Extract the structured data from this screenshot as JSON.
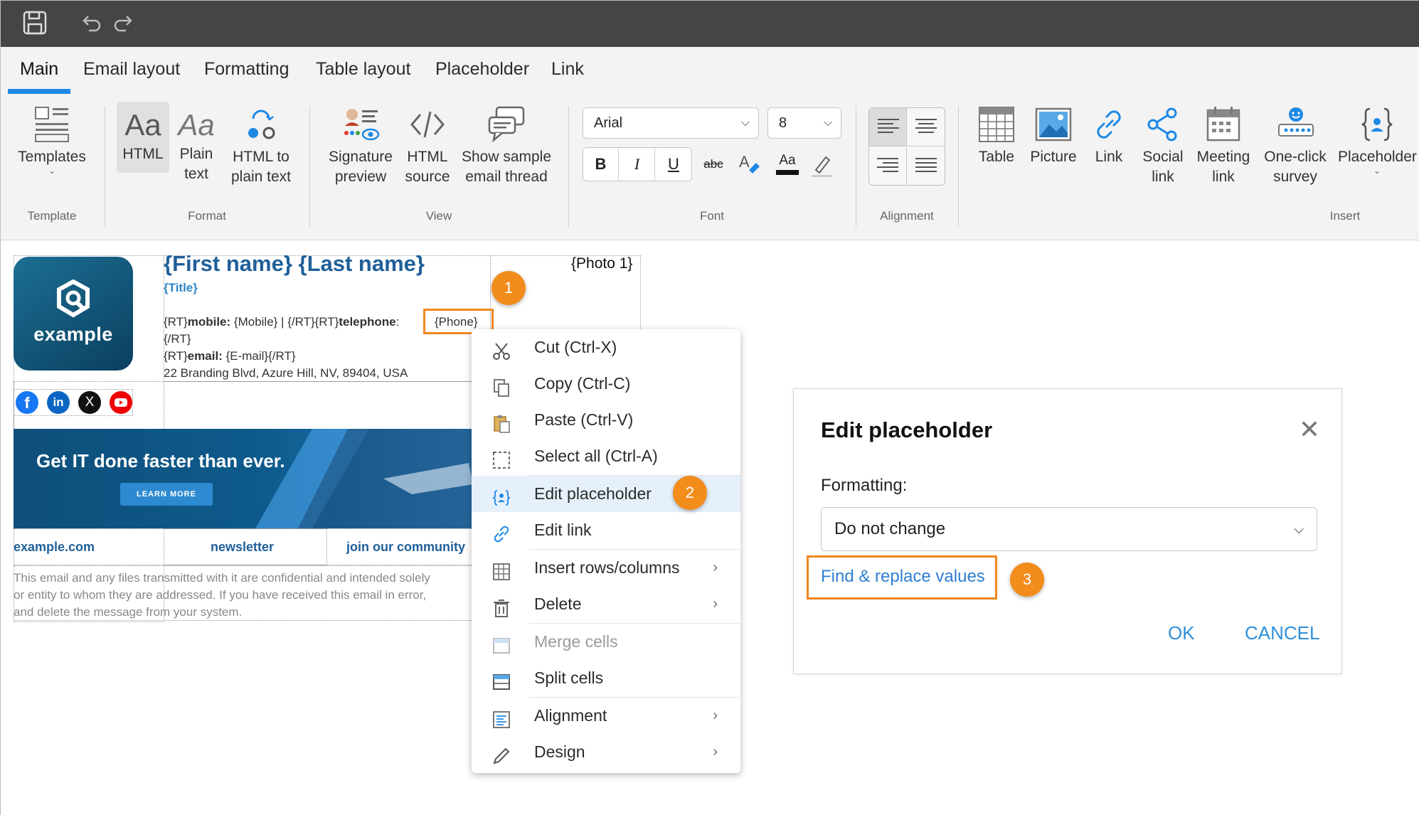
{
  "titlebar": {
    "icons": [
      "save-icon",
      "undo-icon",
      "redo-icon"
    ]
  },
  "tabs": [
    {
      "label": "Main"
    },
    {
      "label": "Email layout"
    },
    {
      "label": "Formatting"
    },
    {
      "label": "Table layout"
    },
    {
      "label": "Placeholder"
    },
    {
      "label": "Link"
    }
  ],
  "ribbon": {
    "templates": "Templates",
    "html": "HTML",
    "html_icon_text": "Aa",
    "plain_text": "Plain text",
    "plain_icon_text": "Aa",
    "html_to_plain": "HTML to plain text",
    "signature_preview": "Signature preview",
    "html_source": "HTML source",
    "show_sample": "Show sample email thread",
    "font_name": "Arial",
    "font_size": "8",
    "bold": "B",
    "italic": "I",
    "underline": "U",
    "strike": "abc",
    "aa": "Aa",
    "table": "Table",
    "picture": "Picture",
    "link": "Link",
    "social_link": "Social link",
    "meeting_link": "Meeting link",
    "one_click_survey": "One-click survey",
    "placeholder": "Placeholder",
    "groups": {
      "template": "Template",
      "format": "Format",
      "view": "View",
      "font": "Font",
      "alignment": "Alignment",
      "insert": "Insert"
    }
  },
  "signature": {
    "logo_text": "example",
    "name": "{First name} {Last name}",
    "title": "{Title}",
    "photo": "{Photo 1}",
    "line1_a": "{RT}",
    "line1_b": "mobile:",
    "line1_c": " {Mobile}  |  {/RT}{RT}",
    "line1_d": "telephone",
    "line1_e": ":",
    "phone": "{Phone}",
    "line2": "{/RT}",
    "line3_a": "{RT}",
    "line3_b": "email:",
    "line3_c": " {E-mail}{/RT}",
    "address": "22 Branding Blvd, Azure Hill, NV, 89404, USA",
    "banner_headline": "Get IT done faster than ever.",
    "banner_button": "LEARN MORE",
    "link1": "example.com",
    "link2": "newsletter",
    "link3": "join our community",
    "disclaimer1": "This email and any files transmitted with it are confidential and intended solely",
    "disclaimer2": "or entity to whom they are addressed. If you have received this email in error,",
    "disclaimer3": "and delete the message from your system."
  },
  "badges": [
    "1",
    "2",
    "3"
  ],
  "context_menu": [
    {
      "label": "Cut (Ctrl-X)"
    },
    {
      "label": "Copy (Ctrl-C)"
    },
    {
      "label": "Paste (Ctrl-V)"
    },
    {
      "label": "Select all (Ctrl-A)"
    },
    {
      "label": "Edit placeholder"
    },
    {
      "label": "Edit link"
    },
    {
      "label": "Insert rows/columns"
    },
    {
      "label": "Delete"
    },
    {
      "label": "Merge cells",
      "disabled": true
    },
    {
      "label": "Split cells"
    },
    {
      "label": "Alignment"
    },
    {
      "label": "Design"
    }
  ],
  "dialog": {
    "title": "Edit placeholder",
    "formatting_label": "Formatting:",
    "formatting_value": "Do not change",
    "find_replace": "Find & replace values",
    "ok": "OK",
    "cancel": "CANCEL"
  },
  "colors": {
    "accent": "#1e88e5",
    "badge": "#f28c1b",
    "link_blue": "#2f7fd1"
  }
}
